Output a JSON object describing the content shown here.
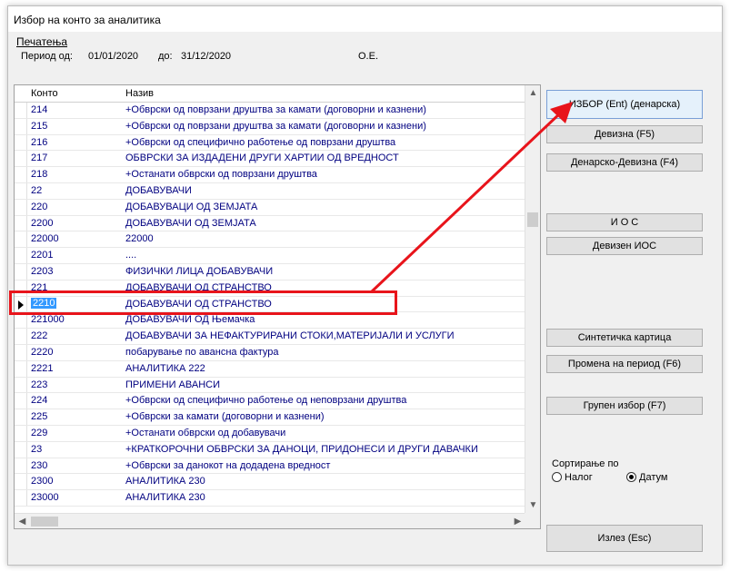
{
  "window": {
    "title": "Избор на конто за аналитика",
    "menu_print": "Печатења",
    "period_label": "Период од:",
    "period_from": "01/01/2020",
    "period_to_label": "до:",
    "period_to": "31/12/2020",
    "org": "О.Е."
  },
  "grid": {
    "col_code": "Конто",
    "col_name": "Назив",
    "rows": [
      {
        "code": "214",
        "name": "+Обврски од поврзани друштва за камати (договорни и казнени)"
      },
      {
        "code": "215",
        "name": "+Обврски од поврзани друштва за камати (договорни и казнени)"
      },
      {
        "code": "216",
        "name": "+Обврски од специфично работење од поврзани друштва"
      },
      {
        "code": "217",
        "name": "ОБВРСКИ ЗА ИЗДАДЕНИ ДРУГИ ХАРТИИ ОД ВРЕДНОСТ"
      },
      {
        "code": "218",
        "name": "+Останати обврски од поврзани друштва"
      },
      {
        "code": "22",
        "name": "ДОБАВУВАЧИ"
      },
      {
        "code": "220",
        "name": "ДОБАВУВАЦИ ОД ЗЕМЈАТА"
      },
      {
        "code": "2200",
        "name": "ДОБАВУВАЧИ ОД ЗЕМЈАТА"
      },
      {
        "code": "22000",
        "name": "22000"
      },
      {
        "code": "2201",
        "name": "...."
      },
      {
        "code": "2203",
        "name": "ФИЗИЧКИ ЛИЦА ДОБАВУВАЧИ"
      },
      {
        "code": "221",
        "name": "ДОБАВУВАЧИ ОД СТРАНСТВО"
      },
      {
        "code": "2210",
        "name": "ДОБАВУВАЧИ ОД СТРАНСТВО"
      },
      {
        "code": "221000",
        "name": "ДОБАВУВАЧИ ОД Њемачка"
      },
      {
        "code": "222",
        "name": "ДОБАВУВАЧИ ЗА НЕФАКТУРИРАНИ СТОКИ,МАТЕРИЈАЛИ И УСЛУГИ"
      },
      {
        "code": "2220",
        "name": "побарување по авансна фактура"
      },
      {
        "code": "2221",
        "name": "АНАЛИТИКА 222"
      },
      {
        "code": "223",
        "name": "ПРИМЕНИ АВАНСИ"
      },
      {
        "code": "224",
        "name": "+Обврски од специфично работење од неповрзани друштва"
      },
      {
        "code": "225",
        "name": "+Обврски за камати (договорни и казнени)"
      },
      {
        "code": "229",
        "name": "+Останати обврски од добавувачи"
      },
      {
        "code": "23",
        "name": "+КРАТКОРОЧНИ ОБВРСКИ ЗА ДАНОЦИ, ПРИДОНЕСИ И ДРУГИ ДАВАЧКИ"
      },
      {
        "code": "230",
        "name": "+Обврски за данокот на додадена вредност"
      },
      {
        "code": "2300",
        "name": "АНАЛИТИКА 230"
      },
      {
        "code": "23000",
        "name": "АНАЛИТИКА 230"
      }
    ],
    "selected_index": 12
  },
  "buttons": {
    "izbor": "ИЗБОР (Ent) (денарска)",
    "devizna": "Девизна (F5)",
    "denarsko_devizna": "Денарско-Девизна (F4)",
    "ios": "И О С",
    "devizen_ios": "Девизен ИОС",
    "sintetichka": "Синтетичка картица",
    "promena": "Промена на период (F6)",
    "grupen": "Групен избор (F7)",
    "izlez": "Излез (Esc)"
  },
  "sort": {
    "label": "Сортирање по",
    "option_nalog": "Налог",
    "option_datum": "Датум",
    "selected": "Датум"
  },
  "colors": {
    "highlight_red": "#e8141b",
    "selection_blue": "#3399ff",
    "text_navy": "#000080"
  }
}
